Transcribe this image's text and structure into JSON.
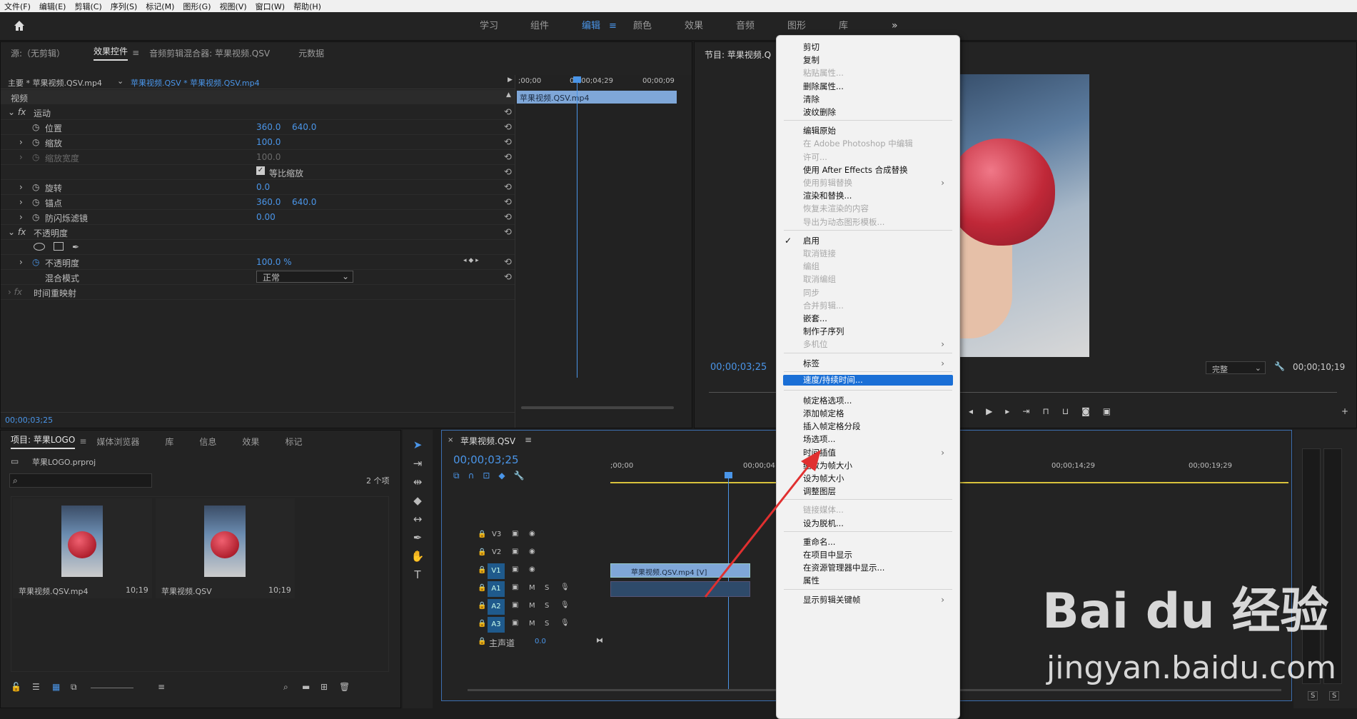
{
  "menubar": [
    "文件(F)",
    "编辑(E)",
    "剪辑(C)",
    "序列(S)",
    "标记(M)",
    "图形(G)",
    "视图(V)",
    "窗口(W)",
    "帮助(H)"
  ],
  "workspaces": [
    "学习",
    "组件",
    "编辑",
    "颜色",
    "效果",
    "音频",
    "图形",
    "库"
  ],
  "workspace_active": "编辑",
  "source_panel": {
    "tabs": [
      "源:（无剪辑）",
      "效果控件",
      "音频剪辑混合器: 苹果视频.QSV",
      "元数据"
    ],
    "master": "主要 * 苹果视频.QSV.mp4",
    "clip": "苹果视频.QSV * 苹果视频.QSV.mp4",
    "ruler": [
      ";00;00",
      "00;00;04;29",
      "00;00;09"
    ],
    "clip_bar": "苹果视频.QSV.mp4",
    "video_label": "视频",
    "motion": "运动",
    "position": {
      "label": "位置",
      "x": "360.0",
      "y": "640.0"
    },
    "scale": {
      "label": "缩放",
      "value": "100.0"
    },
    "scale_width": {
      "label": "缩放宽度",
      "value": "100.0"
    },
    "uniform": "等比缩放",
    "rotation": {
      "label": "旋转",
      "value": "0.0"
    },
    "anchor": {
      "label": "锚点",
      "x": "360.0",
      "y": "640.0"
    },
    "flicker": {
      "label": "防闪烁滤镜",
      "value": "0.00"
    },
    "opacity_group": "不透明度",
    "opacity": {
      "label": "不透明度",
      "value": "100.0 %"
    },
    "blend": {
      "label": "混合模式",
      "value": "正常"
    },
    "time_remap": "时间重映射",
    "timecode": "00;00;03;25"
  },
  "program_panel": {
    "title": "节目: 苹果视频.Q",
    "timecode": "00;00;03;25",
    "duration": "00;00;10;19",
    "quality": "完整"
  },
  "project_panel": {
    "tabs": [
      "项目: 苹果LOGO",
      "媒体浏览器",
      "库",
      "信息",
      "效果",
      "标记"
    ],
    "file": "苹果LOGO.prproj",
    "count": "2 个项",
    "items": [
      {
        "name": "苹果视频.QSV.mp4",
        "duration": "10;19"
      },
      {
        "name": "苹果视频.QSV",
        "duration": "10;19"
      }
    ]
  },
  "timeline": {
    "title": "苹果视频.QSV",
    "timecode": "00;00;03;25",
    "ruler": [
      ";00;00",
      "00;00;04",
      "00;00;14;29",
      "00;00;19;29"
    ],
    "tracks": [
      {
        "id": "V3"
      },
      {
        "id": "V2"
      },
      {
        "id": "V1"
      },
      {
        "id": "A1"
      },
      {
        "id": "A2"
      },
      {
        "id": "A3"
      }
    ],
    "m": "M",
    "s": "S",
    "master": "主声道",
    "master_value": "0.0",
    "clip_v1": "苹果视频.QSV.mp4 [V]"
  },
  "meter": {
    "s1": "S",
    "s2": "S"
  },
  "context_menu": {
    "items": [
      {
        "label": "剪切",
        "enabled": true
      },
      {
        "label": "复制",
        "enabled": true
      },
      {
        "label": "粘贴属性...",
        "enabled": false
      },
      {
        "label": "删除属性...",
        "enabled": true
      },
      {
        "label": "清除",
        "enabled": true
      },
      {
        "label": "波纹删除",
        "enabled": true
      },
      {
        "sep": true
      },
      {
        "label": "编辑原始",
        "enabled": true
      },
      {
        "label": "在 Adobe Photoshop 中编辑",
        "enabled": false
      },
      {
        "label": "许可...",
        "enabled": false
      },
      {
        "label": "使用 After Effects 合成替换",
        "enabled": true
      },
      {
        "label": "使用剪辑替换",
        "enabled": false,
        "submenu": true
      },
      {
        "label": "渲染和替换...",
        "enabled": true
      },
      {
        "label": "恢复未渲染的内容",
        "enabled": false
      },
      {
        "label": "导出为动态图形模板...",
        "enabled": false
      },
      {
        "sep": true
      },
      {
        "label": "启用",
        "enabled": true,
        "checked": true
      },
      {
        "label": "取消链接",
        "enabled": false
      },
      {
        "label": "编组",
        "enabled": false
      },
      {
        "label": "取消编组",
        "enabled": false
      },
      {
        "label": "同步",
        "enabled": false
      },
      {
        "label": "合并剪辑...",
        "enabled": false
      },
      {
        "label": "嵌套...",
        "enabled": true
      },
      {
        "label": "制作子序列",
        "enabled": true
      },
      {
        "label": "多机位",
        "enabled": false,
        "submenu": true
      },
      {
        "sep": true
      },
      {
        "label": "标签",
        "enabled": true,
        "submenu": true
      },
      {
        "sep": true
      },
      {
        "label": "速度/持续时间...",
        "enabled": true,
        "selected": true
      },
      {
        "sep": true
      },
      {
        "label": "帧定格选项...",
        "enabled": true
      },
      {
        "label": "添加帧定格",
        "enabled": true
      },
      {
        "label": "插入帧定格分段",
        "enabled": true
      },
      {
        "label": "场选项...",
        "enabled": true
      },
      {
        "label": "时间插值",
        "enabled": true,
        "submenu": true
      },
      {
        "label": "缩放为帧大小",
        "enabled": true
      },
      {
        "label": "设为帧大小",
        "enabled": true
      },
      {
        "label": "调整图层",
        "enabled": true
      },
      {
        "sep": true
      },
      {
        "label": "链接媒体...",
        "enabled": false
      },
      {
        "label": "设为脱机...",
        "enabled": true
      },
      {
        "sep": true
      },
      {
        "label": "重命名...",
        "enabled": true
      },
      {
        "label": "在项目中显示",
        "enabled": true
      },
      {
        "label": "在资源管理器中显示...",
        "enabled": true
      },
      {
        "label": "属性",
        "enabled": true
      },
      {
        "sep": true
      },
      {
        "label": "显示剪辑关键帧",
        "enabled": true,
        "submenu": true
      }
    ]
  },
  "watermark": {
    "brand": "Bai du 经验",
    "url": "jingyan.baidu.com"
  },
  "colors": {
    "accent": "#4a95e8",
    "menu_highlight": "#1a6fd6",
    "clip": "#7fa7d8"
  }
}
